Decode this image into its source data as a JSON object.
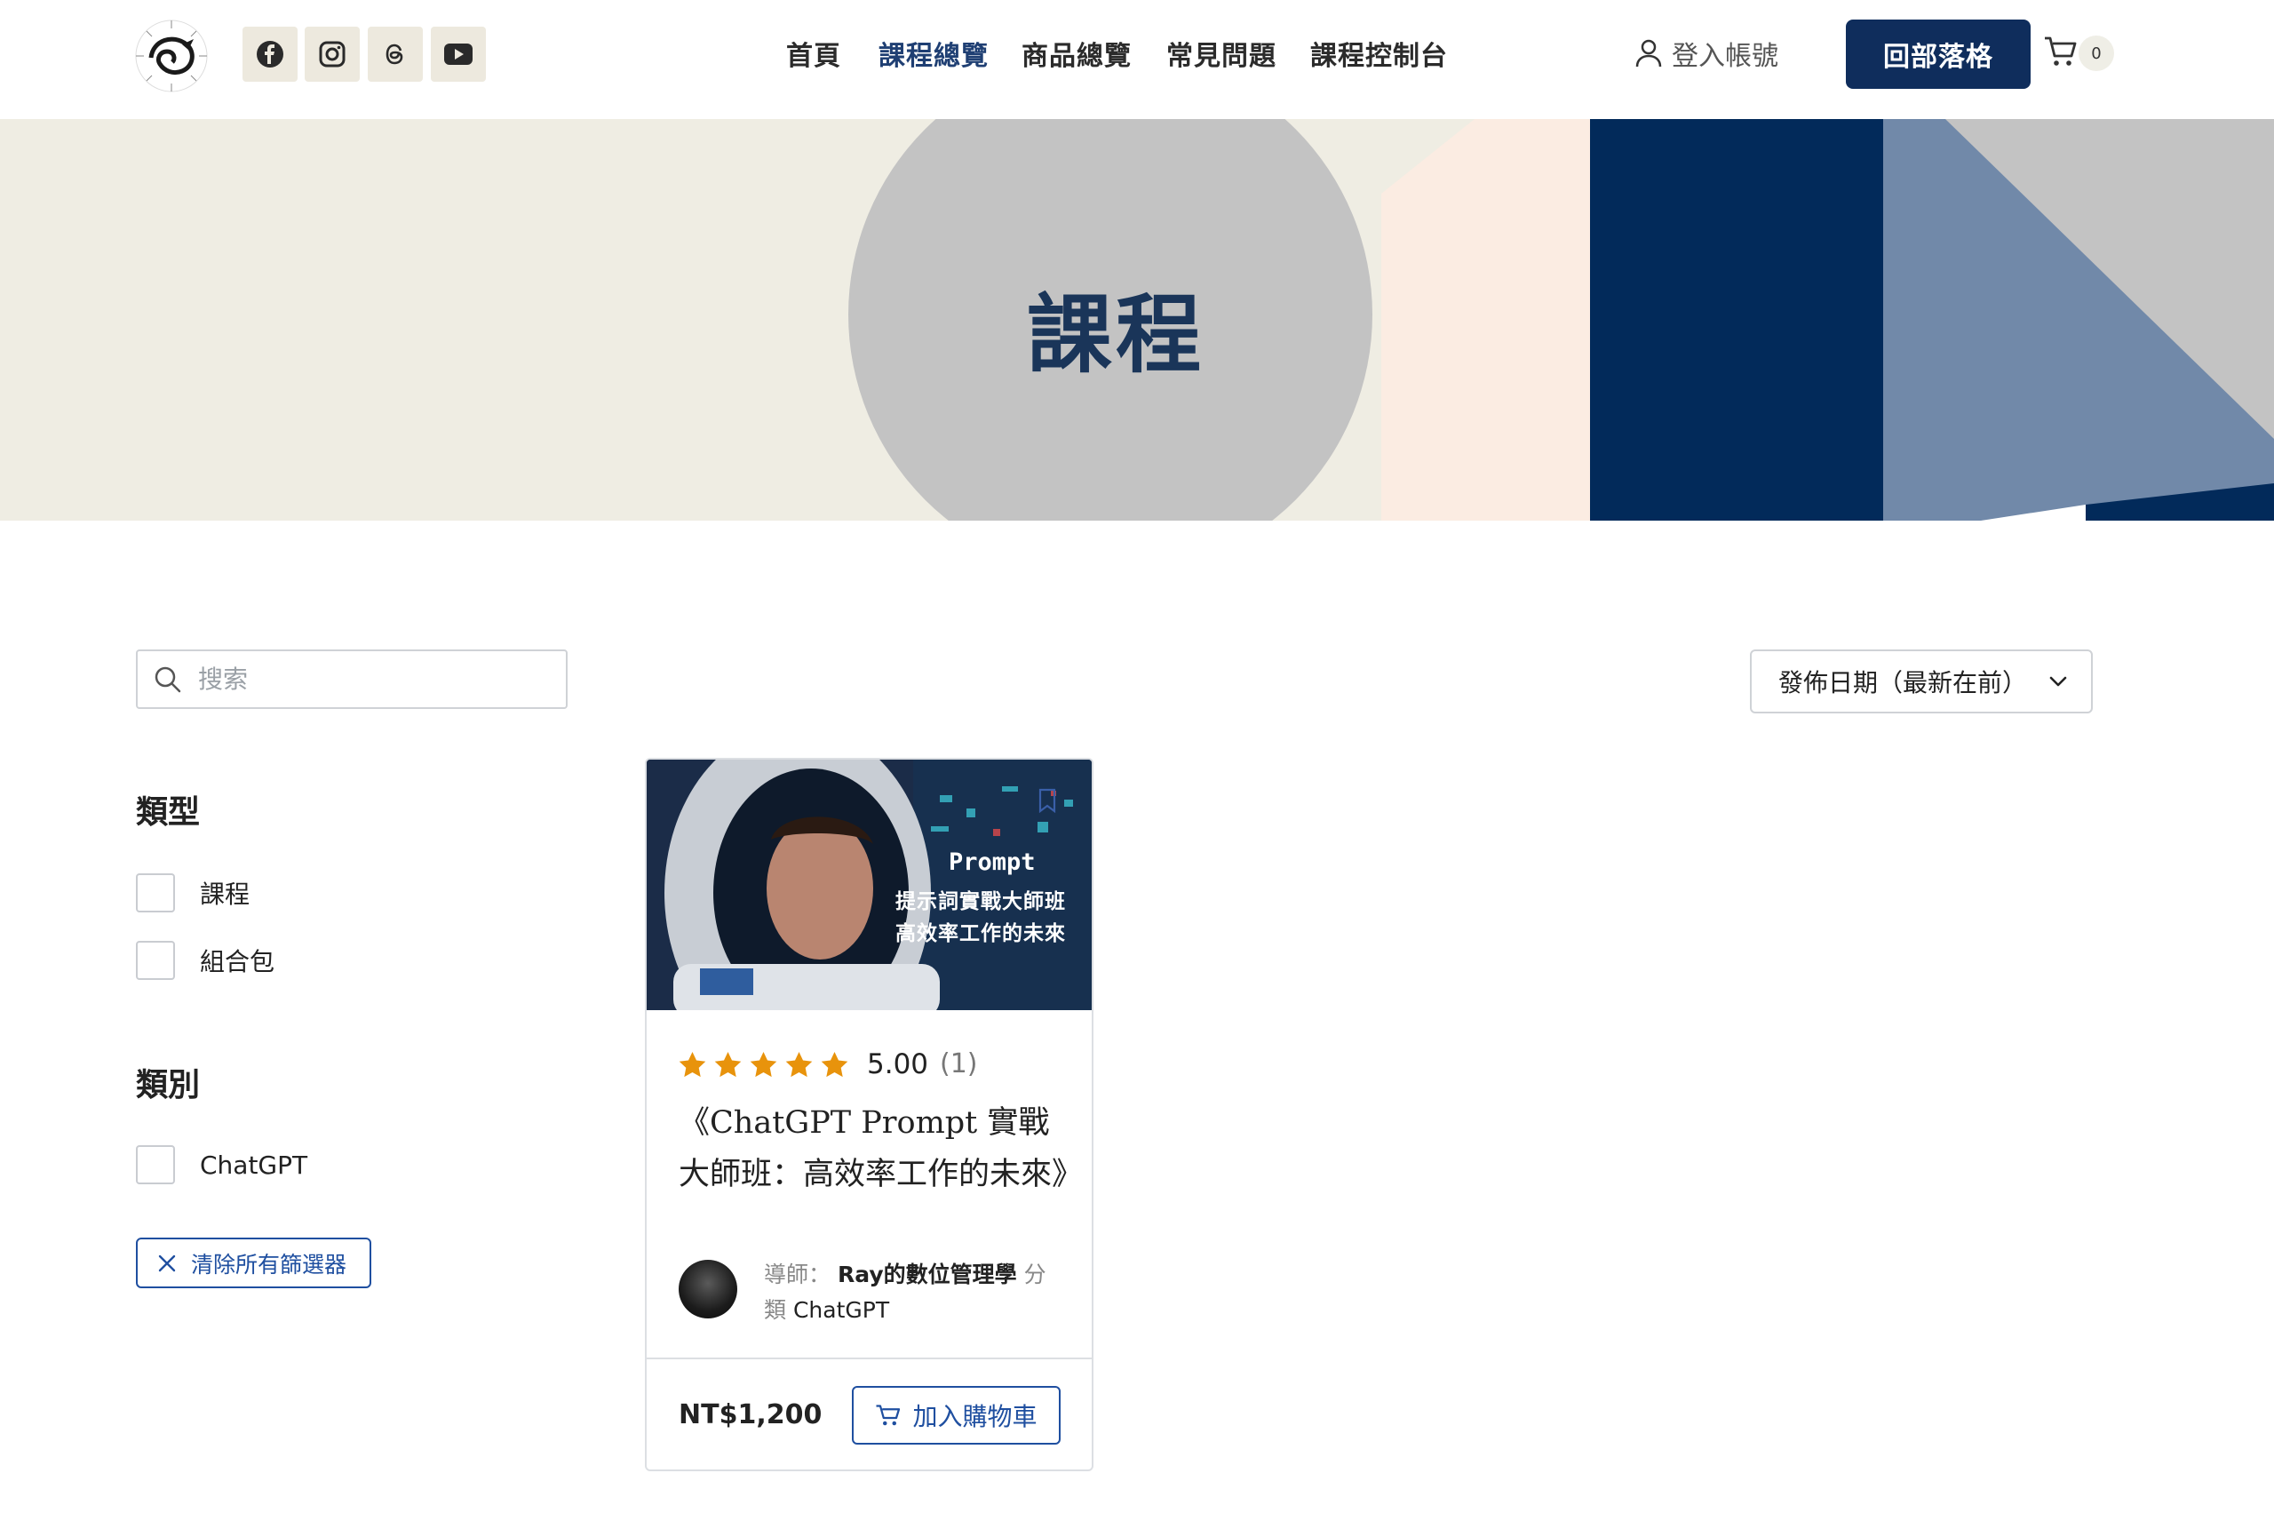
{
  "header": {
    "nav": [
      {
        "label": "首頁",
        "active": false
      },
      {
        "label": "課程總覽",
        "active": true
      },
      {
        "label": "商品總覽",
        "active": false
      },
      {
        "label": "常見問題",
        "active": false
      },
      {
        "label": "課程控制台",
        "active": false
      }
    ],
    "login_label": "登入帳號",
    "blog_button": "回部落格",
    "cart_count": "0",
    "social_icons": [
      "facebook-icon",
      "instagram-icon",
      "threads-icon",
      "youtube-icon"
    ]
  },
  "hero": {
    "title": "課程"
  },
  "search": {
    "placeholder": "搜索",
    "value": ""
  },
  "sort": {
    "selected": "發佈日期（最新在前）"
  },
  "filters": {
    "type_heading": "類型",
    "type_options": [
      {
        "label": "課程",
        "checked": false
      },
      {
        "label": "組合包",
        "checked": false
      }
    ],
    "category_heading": "類別",
    "category_options": [
      {
        "label": "ChatGPT",
        "checked": false
      }
    ],
    "clear_label": "清除所有篩選器"
  },
  "course": {
    "thumbnail_title": "Prompt",
    "thumbnail_line1": "提示詞實戰大師班",
    "thumbnail_line2": "高效率工作的未來",
    "rating": "5.00",
    "rating_count": "(1)",
    "stars": 5,
    "title": "《ChatGPT Prompt 實戰大師班：高效率工作的未來》",
    "instructor_label": "導師：",
    "instructor": "Ray的數位管理學",
    "category_label": "分類",
    "category": "ChatGPT",
    "price": "NT$1,200",
    "add_to_cart": "加入購物車"
  },
  "colors": {
    "brand": "#0f2d5c",
    "accent": "#1f4fa0",
    "star": "#e8930c",
    "hero_bg": "#efede3"
  }
}
